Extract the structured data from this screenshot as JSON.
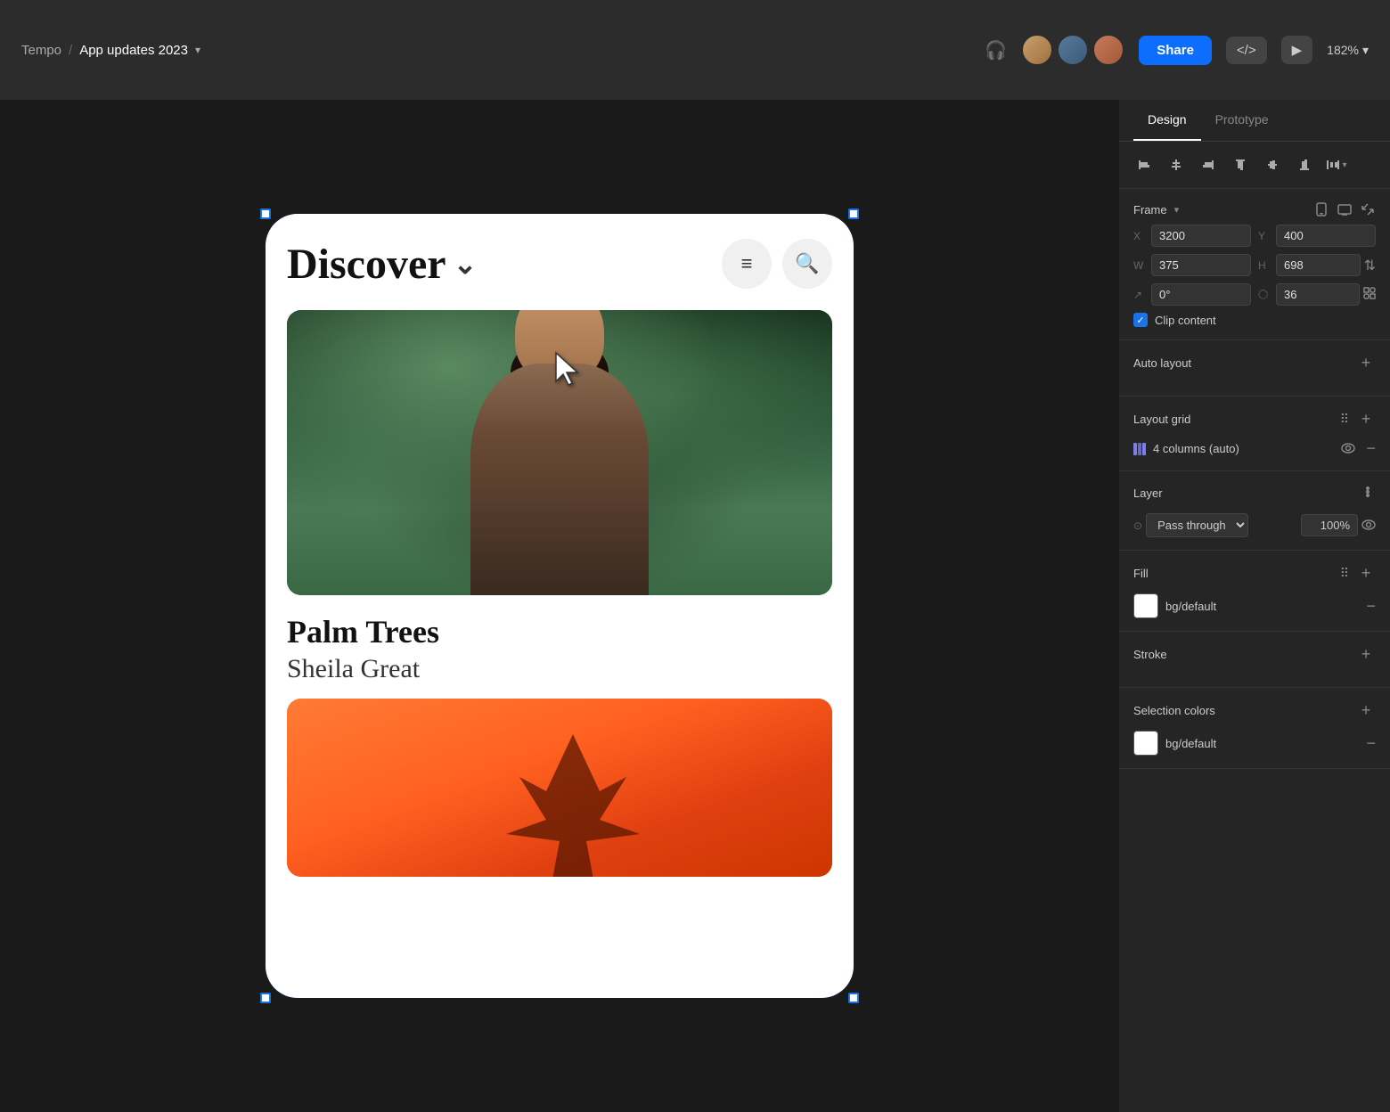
{
  "topbar": {
    "breadcrumb_app": "Tempo",
    "breadcrumb_sep": "/",
    "breadcrumb_page": "App updates 2023",
    "share_label": "Share",
    "zoom_level": "182%",
    "code_icon": "</>",
    "play_icon": "▶"
  },
  "right_panel": {
    "tabs": [
      {
        "label": "Design",
        "active": true
      },
      {
        "label": "Prototype",
        "active": false
      }
    ],
    "frame_section": {
      "title": "Frame",
      "x_label": "X",
      "x_value": "3200",
      "y_label": "Y",
      "y_value": "400",
      "w_label": "W",
      "w_value": "375",
      "h_label": "H",
      "h_value": "698",
      "rotation_label": "↗",
      "rotation_value": "0°",
      "corner_label": "◯",
      "corner_value": "36",
      "clip_content": "Clip content"
    },
    "auto_layout": {
      "title": "Auto layout"
    },
    "layout_grid": {
      "title": "Layout grid",
      "columns_label": "4 columns (auto)"
    },
    "layer": {
      "title": "Layer",
      "blend_mode": "Pass through",
      "opacity_value": "100%"
    },
    "fill": {
      "title": "Fill",
      "swatch_color": "#ffffff",
      "fill_label": "bg/default"
    },
    "stroke": {
      "title": "Stroke"
    },
    "selection_colors": {
      "title": "Selection colors",
      "swatch_color": "#ffffff",
      "fill_label": "bg/default"
    }
  },
  "canvas": {
    "frame_title": "Discover",
    "card1_title": "Palm Trees",
    "card1_subtitle": "Sheila Great"
  }
}
